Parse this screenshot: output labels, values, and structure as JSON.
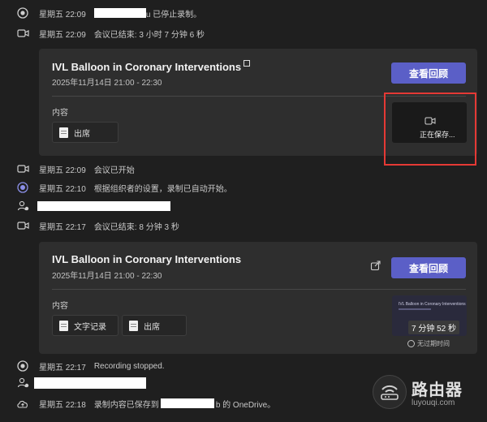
{
  "feed": {
    "row1": {
      "time": "星期五 22:09",
      "suffix": "u 已停止录制。"
    },
    "row2": {
      "time": "星期五 22:09",
      "text": "会议已结束: 3 小时 7 分钟 6 秒"
    },
    "row3": {
      "time": "星期五 22:09",
      "text": "会议已开始"
    },
    "row4": {
      "time": "星期五 22:10",
      "text": "根据组织者的设置，录制已自动开始。"
    },
    "row5": {
      "time": "星期五 22:17",
      "text": "会议已结束: 8 分钟 3 秒"
    },
    "row6": {
      "time": "星期五 22:17",
      "text": "Recording stopped."
    },
    "row7": {
      "time": "星期五 22:18",
      "prefix": "录制内容已保存到",
      "suffix": "b 的 OneDrive。"
    }
  },
  "card1": {
    "title": "IVL Balloon in Coronary Interventions",
    "datetime": "2025年11月14日 21:00 - 22:30",
    "view_button": "查看回顾",
    "content_label": "内容",
    "attendance": "出席",
    "saving_status": "正在保存..."
  },
  "card2": {
    "title": "IVL Balloon in Coronary Interventions",
    "datetime": "2025年11月14日 21:00 - 22:30",
    "view_button": "查看回顾",
    "content_label": "内容",
    "transcript": "文字记录",
    "attendance": "出席",
    "thumb_title": "IVL Balloon in Coronary Interventions",
    "duration": "7 分钟 52 秒",
    "expiry": "无过期时间"
  },
  "watermark": {
    "title": "路由器",
    "subtitle": "luyouqi.com"
  },
  "colors": {
    "background": "#1f1f1f",
    "card": "#2e2e2e",
    "accent": "#5b5fc7",
    "highlight": "#e53935"
  }
}
